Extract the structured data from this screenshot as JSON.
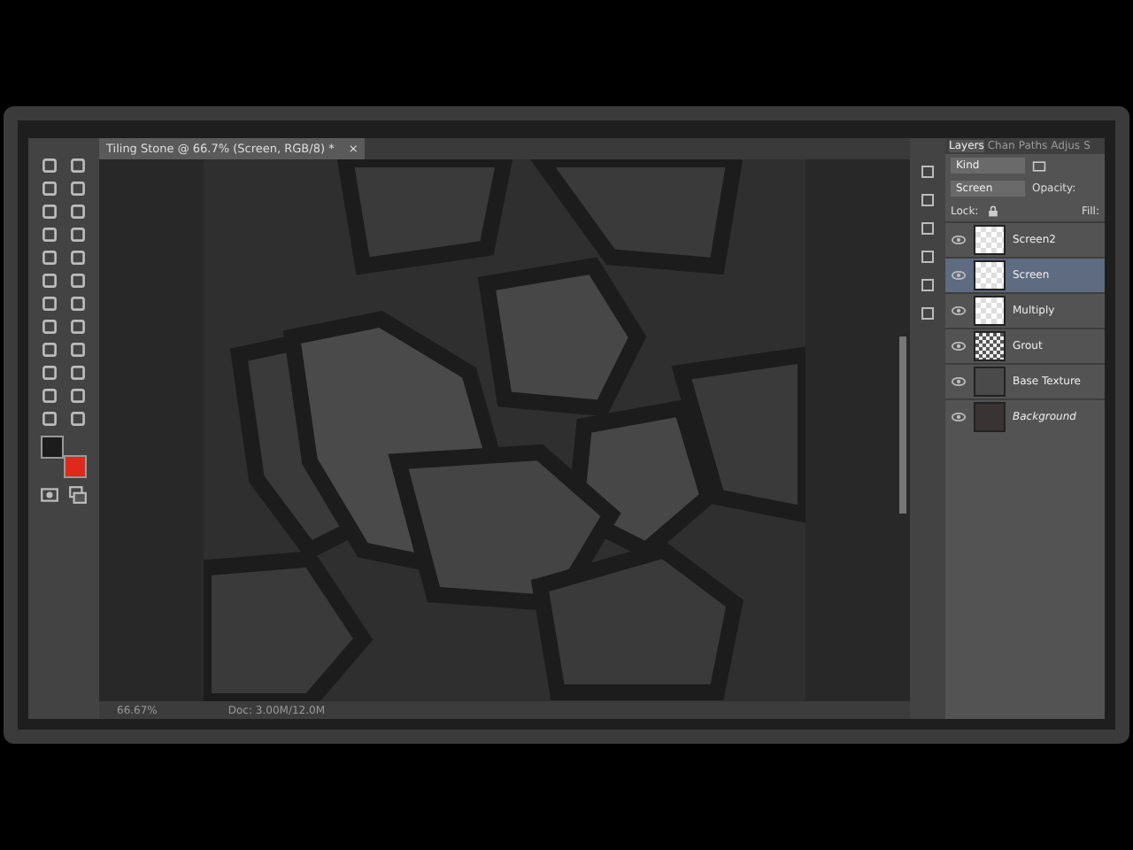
{
  "document_tab": {
    "title": "Tiling Stone @ 66.7% (Screen, RGB/8) *",
    "close": "×"
  },
  "color_swatches": [
    {
      "kind": "foreground",
      "color": "#1c1c1c"
    },
    {
      "kind": "background",
      "color": "#e0281e"
    }
  ],
  "status_bar": {
    "zoom": "66.67%",
    "doc": "Doc: 3.00M/12.0M"
  },
  "panel_tabs": [
    {
      "label": "Layers",
      "selected": true
    },
    {
      "label": "Chan",
      "selected": false
    },
    {
      "label": "Paths",
      "selected": false
    },
    {
      "label": "Adjus",
      "selected": false
    },
    {
      "label": "S",
      "selected": false
    }
  ],
  "filter": {
    "value": "Kind"
  },
  "blend": {
    "mode": "Screen",
    "opacity_label": "Opacity:"
  },
  "lock": {
    "label": "Lock:",
    "fill_label": "Fill:"
  },
  "layers": [
    {
      "name": "Screen2",
      "visible": true,
      "selected": false,
      "italic": false,
      "kind": "transparent"
    },
    {
      "name": "Screen",
      "visible": true,
      "selected": true,
      "italic": false,
      "kind": "transparent"
    },
    {
      "name": "Multiply",
      "visible": true,
      "selected": false,
      "italic": false,
      "kind": "transparent"
    },
    {
      "name": "Grout",
      "visible": true,
      "selected": false,
      "italic": false,
      "kind": "pattern"
    },
    {
      "name": "Base Texture",
      "visible": true,
      "selected": false,
      "italic": false,
      "kind": "texture"
    },
    {
      "name": "Background",
      "visible": true,
      "selected": false,
      "italic": true,
      "kind": "solid"
    }
  ]
}
